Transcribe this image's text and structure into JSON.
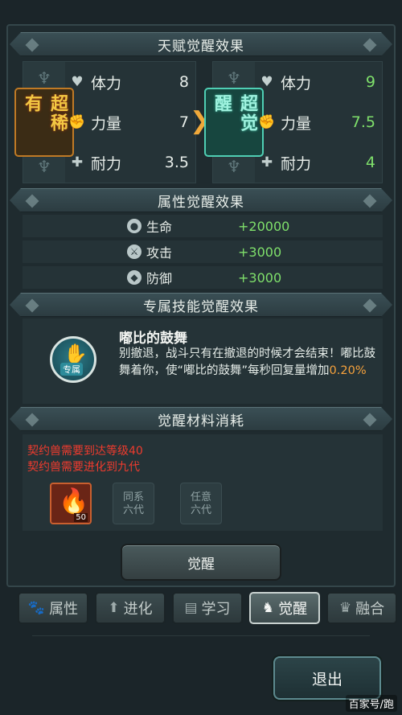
{
  "sections": {
    "talent_title": "天赋觉醒效果",
    "attr_title": "属性觉醒效果",
    "skill_title": "专属技能觉醒效果",
    "material_title": "觉醒材料消耗"
  },
  "talent": {
    "before_rarity": "超稀有",
    "after_rarity": "超觉醒",
    "before": [
      {
        "name": "体力",
        "value": "8",
        "icon": "heart-icon"
      },
      {
        "name": "力量",
        "value": "7",
        "icon": "fist-icon"
      },
      {
        "name": "耐力",
        "value": "3.5",
        "icon": "plus-icon"
      }
    ],
    "after": [
      {
        "name": "体力",
        "value": "9",
        "icon": "heart-icon"
      },
      {
        "name": "力量",
        "value": "7.5",
        "icon": "fist-icon"
      },
      {
        "name": "耐力",
        "value": "4",
        "icon": "plus-icon"
      }
    ]
  },
  "attributes": [
    {
      "name": "生命",
      "value": "+20000",
      "icon": "life-icon"
    },
    {
      "name": "攻击",
      "value": "+3000",
      "icon": "attack-icon"
    },
    {
      "name": "防御",
      "value": "+3000",
      "icon": "shield-icon"
    }
  ],
  "skill": {
    "name": "嘟比的鼓舞",
    "desc_main": "别撤退，战斗只有在撤退的时候才会结束！嘟比鼓舞着你，使“嘟比的鼓舞”每秒回复量增加",
    "desc_value": "0.20%",
    "icon_tag": "专属"
  },
  "materials": {
    "req1": "契约兽需要到达等级40",
    "req2": "契约兽需要进化到九代",
    "item_count": "50",
    "slot1": [
      "同系",
      "六代"
    ],
    "slot2": [
      "任意",
      "六代"
    ]
  },
  "buttons": {
    "awaken": "觉醒",
    "exit": "退出"
  },
  "tabs": [
    {
      "label": "属性",
      "icon": "paw-icon"
    },
    {
      "label": "进化",
      "icon": "arrow-up-icon"
    },
    {
      "label": "学习",
      "icon": "book-icon"
    },
    {
      "label": "觉醒",
      "icon": "beast-icon"
    },
    {
      "label": "融合",
      "icon": "fusion-icon"
    }
  ],
  "active_tab": "觉醒",
  "watermark": "百家号/跑"
}
